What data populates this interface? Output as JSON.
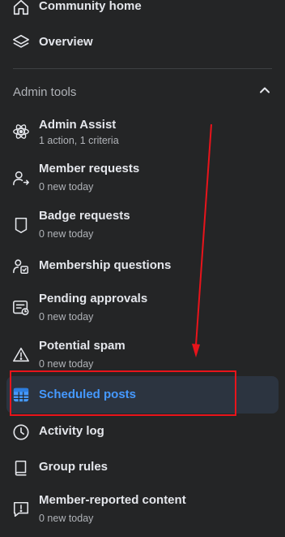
{
  "nav": {
    "community_home": "Community home",
    "overview": "Overview"
  },
  "admin_tools": {
    "title": "Admin tools",
    "items": [
      {
        "label": "Admin Assist",
        "sub": "1 action, 1 criteria",
        "icon": "atom-icon"
      },
      {
        "label": "Member requests",
        "sub": "0 new today",
        "icon": "person-arrow-icon"
      },
      {
        "label": "Badge requests",
        "sub": "0 new today",
        "icon": "badge-icon"
      },
      {
        "label": "Membership questions",
        "sub": "",
        "icon": "person-clipboard-icon"
      },
      {
        "label": "Pending approvals",
        "sub": "0 new today",
        "icon": "feed-clock-icon"
      },
      {
        "label": "Potential spam",
        "sub": "0 new today",
        "icon": "warning-icon"
      },
      {
        "label": "Scheduled posts",
        "sub": "",
        "icon": "calendar-icon"
      },
      {
        "label": "Activity log",
        "sub": "",
        "icon": "clock-icon"
      },
      {
        "label": "Group rules",
        "sub": "",
        "icon": "book-icon"
      },
      {
        "label": "Member-reported content",
        "sub": "0 new today",
        "icon": "report-icon"
      }
    ]
  },
  "colors": {
    "background": "#242526",
    "selected_bg": "#2c3440",
    "accent": "#4599ff",
    "annotation": "#e8141b"
  }
}
